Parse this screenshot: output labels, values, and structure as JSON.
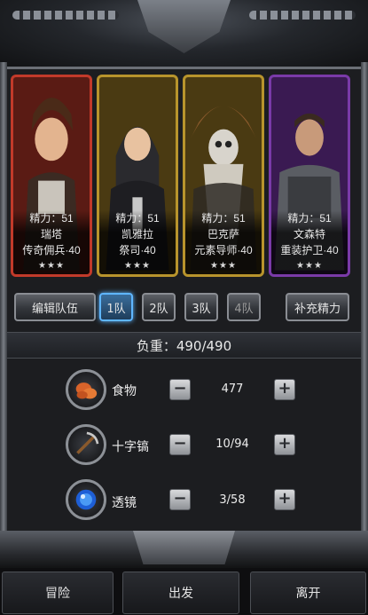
{
  "characters": [
    {
      "energy": "精力：51",
      "name": "瑞塔",
      "class_level": "传奇佣兵·40",
      "stars": "★★★",
      "border": "#c23a2a",
      "bg": "#5a1b14"
    },
    {
      "energy": "精力：51",
      "name": "凯雅拉",
      "class_level": "祭司·40",
      "stars": "★★★",
      "border": "#b8942c",
      "bg": "#4a3a12"
    },
    {
      "energy": "精力：51",
      "name": "巴克萨",
      "class_level": "元素导师·40",
      "stars": "★★★",
      "border": "#b8942c",
      "bg": "#4a3a12"
    },
    {
      "energy": "精力：51",
      "name": "文森特",
      "class_level": "重装护卫·40",
      "stars": "★★★",
      "border": "#7a3aa8",
      "bg": "#3a1a52"
    }
  ],
  "team_bar": {
    "edit_team": "编辑队伍",
    "teams": [
      "1队",
      "2队",
      "3队",
      "4队"
    ],
    "refill_energy": "补充精力"
  },
  "weight": "负重：490/490",
  "items": [
    {
      "name": "食物",
      "quantity": "477",
      "icon": "food-icon"
    },
    {
      "name": "十字镐",
      "quantity": "10/94",
      "icon": "pickaxe-icon"
    },
    {
      "name": "透镜",
      "quantity": "3/58",
      "icon": "lens-icon"
    }
  ],
  "stepper": {
    "minus": "−",
    "plus": "+"
  },
  "bottom": {
    "adventure": "冒险",
    "depart": "出发",
    "leave": "离开"
  }
}
